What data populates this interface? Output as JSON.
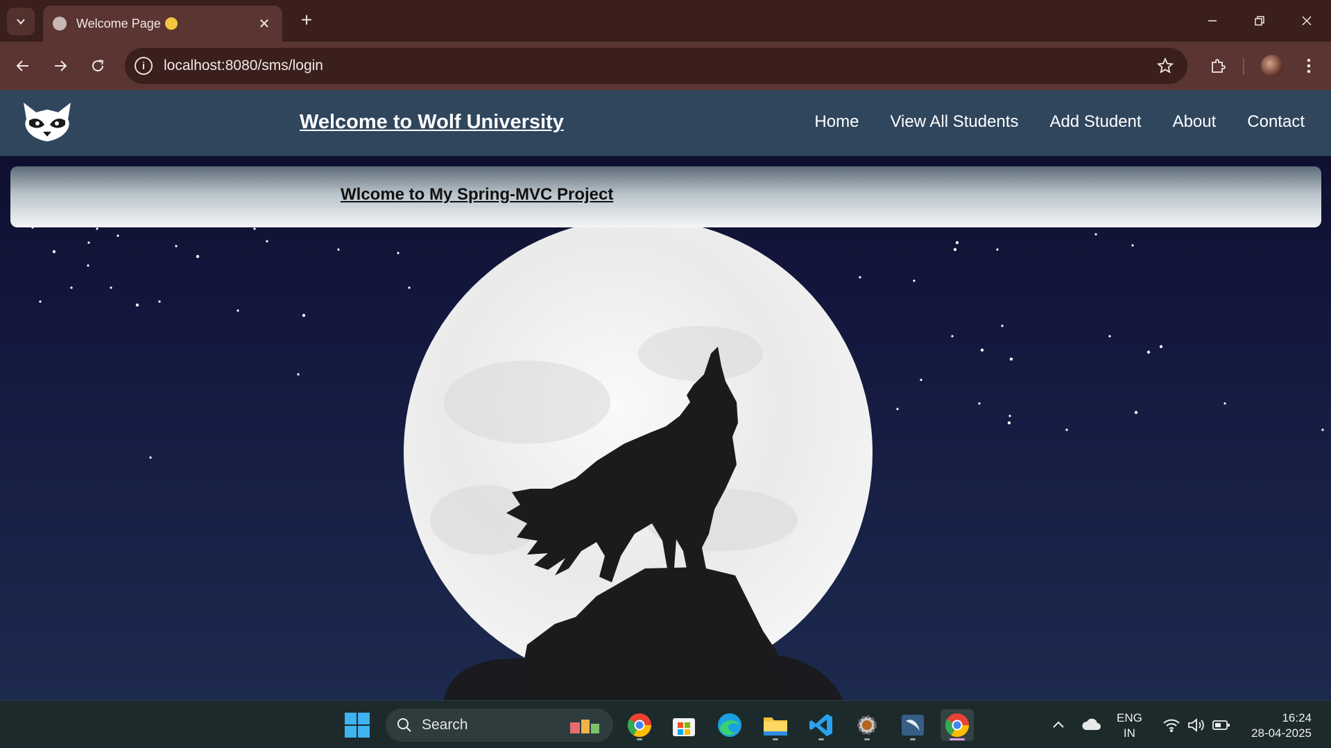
{
  "browser": {
    "tab_title": "Welcome Page",
    "url": "localhost:8080/sms/login"
  },
  "site": {
    "brand": "Welcome to Wolf University",
    "nav": [
      "Home",
      "View All Students",
      "Add Student",
      "About",
      "Contact"
    ],
    "banner_text": "Wlcome to My Spring-MVC Project"
  },
  "taskbar": {
    "search_label": "Search",
    "language": "ENG",
    "region": "IN",
    "time": "16:24",
    "date": "28-04-2025"
  },
  "colors": {
    "browser_frame": "#3a1f1c",
    "navbar": "#2f465d",
    "moon": "#ececec",
    "wolf": "#1b1b1d",
    "sky_top": "#0d0d2b",
    "sky_bottom": "#1c2a4e"
  }
}
